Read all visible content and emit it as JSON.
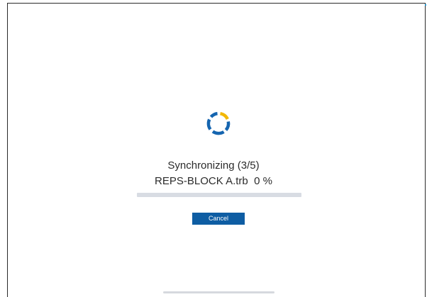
{
  "sync": {
    "title": "Synchronizing (3/5)",
    "file_name": "REPS-BLOCK A.trb",
    "percent_text": "0 %",
    "progress": 0
  },
  "buttons": {
    "cancel_label": "Cancel"
  },
  "colors": {
    "accent": "#0e5da3",
    "spinner_blue": "#1565b0",
    "spinner_yellow": "#f2b705",
    "track": "#d8dce3"
  },
  "icons": {
    "spinner": "loading-spinner-icon"
  }
}
